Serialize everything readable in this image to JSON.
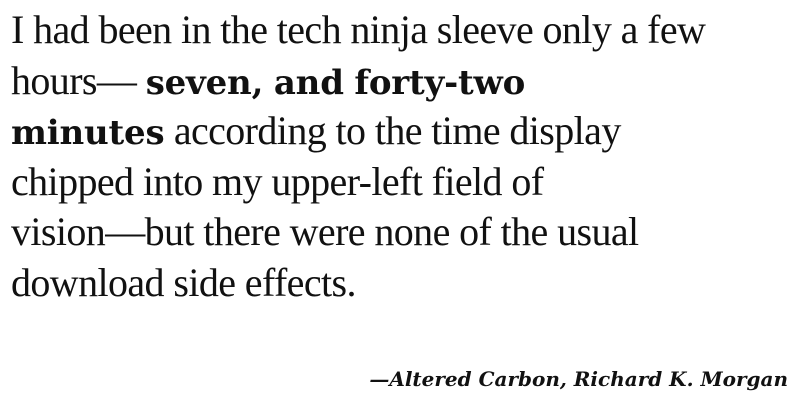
{
  "quote": {
    "line1": "I had been in the tech ninja sleeve only a few",
    "line2_regular": "hours— ",
    "line2_bold": "seven, and forty-two",
    "line3_bold": "minutes",
    "line3_regular": " according to the time display",
    "line4": "chipped into my upper-left field of",
    "line5": "vision—but there were none of the usual",
    "line6": "download side effects."
  },
  "attribution": "—Altered Carbon, Richard K. Morgan"
}
